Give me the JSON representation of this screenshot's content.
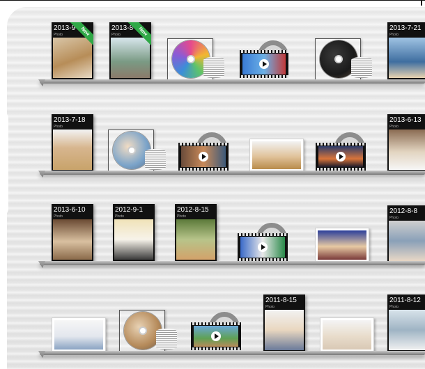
{
  "albums": {
    "a1": {
      "date": "2013-9-",
      "sub": "Photo",
      "new_label": "New"
    },
    "a2": {
      "date": "2013-8-",
      "sub": "Photo",
      "new_label": "New"
    },
    "a3": {
      "date": "2013-7-21",
      "sub": "Photo"
    },
    "a4": {
      "date": "2013-7-18",
      "sub": "Photo"
    },
    "a5": {
      "date": "2013-6-13",
      "sub": "Photo"
    },
    "a6": {
      "date": "2013-6-10",
      "sub": "Photo"
    },
    "a7": {
      "date": "2012-9-1",
      "sub": "Photo"
    },
    "a8": {
      "date": "2012-8-15",
      "sub": "Photo"
    },
    "a9": {
      "date": "2012-8-8",
      "sub": "Photo"
    },
    "a10": {
      "date": "2011-8-15",
      "sub": "Photo"
    },
    "a11": {
      "date": "2011-8-12",
      "sub": "Photo"
    }
  },
  "colors": {
    "accent_new": "#2fa846",
    "album_bg": "#111111",
    "shelf": "#8a8a8a",
    "wall": "#e8e8e8"
  },
  "icons": [
    "film-reel-icon",
    "play-icon",
    "disc-icon",
    "disc-stack-icon",
    "new-ribbon-icon"
  ]
}
